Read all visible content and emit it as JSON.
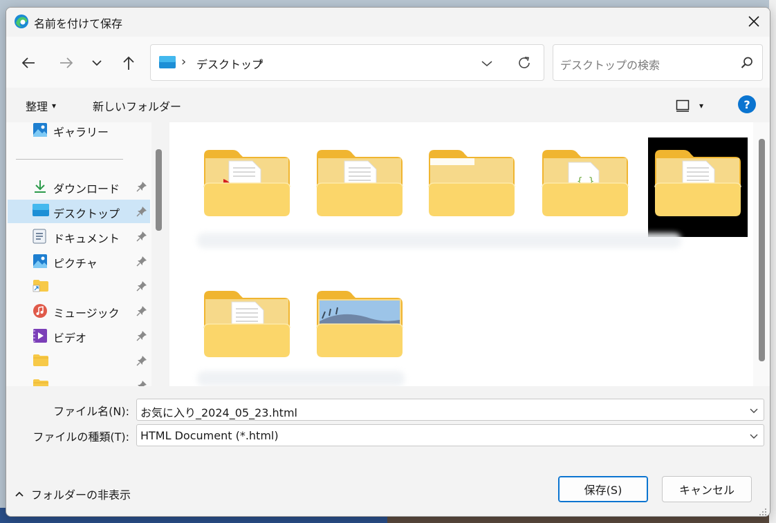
{
  "window": {
    "title": "名前を付けて保存",
    "app_icon": "edge-browser-icon",
    "close": "close-icon"
  },
  "nav": {
    "back": "arrow-left-icon",
    "forward": "arrow-right-icon",
    "recent": "chevron-down-icon",
    "up": "arrow-up-icon"
  },
  "address": {
    "location_icon": "desktop-icon",
    "separator": "›",
    "crumb": "デスクトップ",
    "trailing_separator": "›",
    "dropdown": "chevron-down-icon",
    "refresh": "refresh-icon"
  },
  "search": {
    "placeholder": "デスクトップの検索",
    "icon": "search-icon"
  },
  "commands": {
    "organize": "整理",
    "organize_arrow": "▾",
    "new_folder": "新しいフォルダー",
    "view_icon": "view-layout-icon",
    "view_arrow": "▾",
    "help": "?"
  },
  "sidebar": {
    "items": [
      {
        "label": "ギャラリー",
        "icon": "gallery-icon",
        "pinned": false
      },
      {
        "label": "ダウンロード",
        "icon": "download-icon",
        "pinned": true
      },
      {
        "label": "デスクトップ",
        "icon": "desktop-icon",
        "pinned": true,
        "selected": true
      },
      {
        "label": "ドキュメント",
        "icon": "document-icon",
        "pinned": true
      },
      {
        "label": "ピクチャ",
        "icon": "pictures-icon",
        "pinned": true
      },
      {
        "label": "",
        "icon": "folder-shortcut-icon",
        "pinned": true
      },
      {
        "label": "ミュージック",
        "icon": "music-icon",
        "pinned": true
      },
      {
        "label": "ビデオ",
        "icon": "video-icon",
        "pinned": true
      },
      {
        "label": "",
        "icon": "folder-icon",
        "pinned": true
      },
      {
        "label": "",
        "icon": "folder-icon",
        "pinned": true
      }
    ]
  },
  "folders": [
    {
      "kind": "pdf-document",
      "label": ""
    },
    {
      "kind": "document",
      "label": ""
    },
    {
      "kind": "empty",
      "label": ""
    },
    {
      "kind": "code-file",
      "label": ""
    },
    {
      "kind": "document",
      "label": "",
      "selected": true
    },
    {
      "kind": "document",
      "label": ""
    },
    {
      "kind": "photo",
      "label": ""
    }
  ],
  "fields": {
    "filename_label": "ファイル名(N):",
    "filename_value": "お気に入り_2024_05_23.html",
    "filetype_label": "ファイルの種類(T):",
    "filetype_value": "HTML Document (*.html)"
  },
  "footer": {
    "hide_folders": "フォルダーの非表示",
    "save": "保存(S)",
    "cancel": "キャンセル"
  }
}
